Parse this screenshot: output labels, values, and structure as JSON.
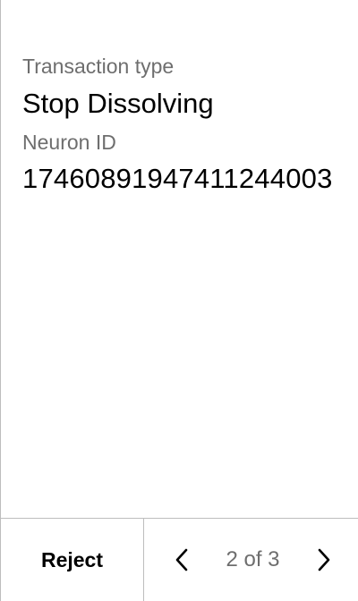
{
  "transaction": {
    "type_label": "Transaction type",
    "type_value": "Stop Dissolving",
    "neuron_label": "Neuron ID",
    "neuron_value": "17460891947411244003"
  },
  "footer": {
    "reject_label": "Reject",
    "page_indicator": "2 of 3",
    "prev_icon": "chevron-left-icon",
    "next_icon": "chevron-right-icon"
  }
}
